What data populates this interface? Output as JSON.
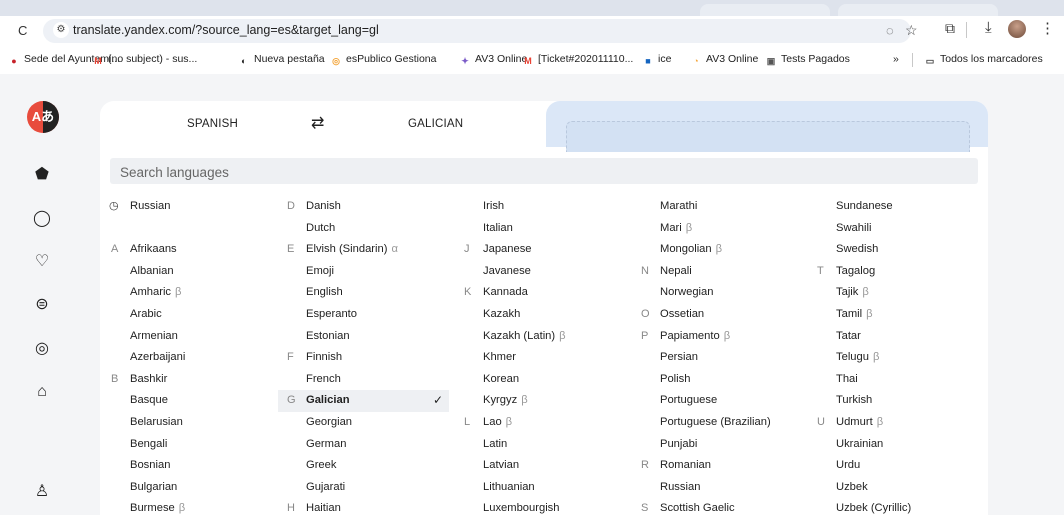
{
  "browser": {
    "url": "translate.yandex.com/?source_lang=es&target_lang=gl",
    "bookmarks": [
      {
        "label": "Sede del Ayuntami...",
        "icon_color": "#c7222a",
        "icon": "●"
      },
      {
        "label": "(no subject) - sus...",
        "icon_color": "#ea4335",
        "icon": "M"
      },
      {
        "label": "Nueva pestaña",
        "icon_color": "#222",
        "icon": "◐"
      },
      {
        "label": "esPublico Gestiona",
        "icon_color": "#f4a63b",
        "icon": "◎"
      },
      {
        "label": "AV3 Online",
        "icon_color": "#7b5cc8",
        "icon": "✦"
      },
      {
        "label": "[Ticket#202011110...",
        "icon_color": "#ea4335",
        "icon": "M"
      },
      {
        "label": "ice",
        "icon_color": "#1565c0",
        "icon": "■"
      },
      {
        "label": "AV3 Online",
        "icon_color": "#f4a63b",
        "icon": "◔"
      },
      {
        "label": "Tests Pagados",
        "icon_color": "#555",
        "icon": "▣"
      }
    ],
    "overflow": "»",
    "all_bookmarks": "Todos los marcadores"
  },
  "app": {
    "logo_text": "Aあ",
    "source_lang": "SPANISH",
    "target_lang": "GALICIAN",
    "swap_icon": "⇄",
    "search_placeholder": "Search languages"
  },
  "columns": [
    [
      {
        "recent": true,
        "name": "Russian"
      },
      {
        "gap": true
      },
      {
        "letter": "A",
        "name": "Afrikaans"
      },
      {
        "name": "Albanian"
      },
      {
        "name": "Amharic",
        "beta": "β"
      },
      {
        "name": "Arabic"
      },
      {
        "name": "Armenian"
      },
      {
        "name": "Azerbaijani"
      },
      {
        "letter": "B",
        "name": "Bashkir"
      },
      {
        "name": "Basque"
      },
      {
        "name": "Belarusian"
      },
      {
        "name": "Bengali"
      },
      {
        "name": "Bosnian"
      },
      {
        "name": "Bulgarian"
      },
      {
        "name": "Burmese",
        "beta": "β"
      }
    ],
    [
      {
        "letter": "D",
        "name": "Danish"
      },
      {
        "name": "Dutch"
      },
      {
        "letter": "E",
        "name": "Elvish (Sindarin)",
        "beta": "α"
      },
      {
        "name": "Emoji"
      },
      {
        "name": "English"
      },
      {
        "name": "Esperanto"
      },
      {
        "name": "Estonian"
      },
      {
        "letter": "F",
        "name": "Finnish"
      },
      {
        "name": "French"
      },
      {
        "letter": "G",
        "name": "Galician",
        "selected": true
      },
      {
        "name": "Georgian"
      },
      {
        "name": "German"
      },
      {
        "name": "Greek"
      },
      {
        "name": "Gujarati"
      },
      {
        "letter": "H",
        "name": "Haitian"
      }
    ],
    [
      {
        "name": "Irish"
      },
      {
        "name": "Italian"
      },
      {
        "letter": "J",
        "name": "Japanese"
      },
      {
        "name": "Javanese"
      },
      {
        "letter": "K",
        "name": "Kannada"
      },
      {
        "name": "Kazakh"
      },
      {
        "name": "Kazakh (Latin)",
        "beta": "β"
      },
      {
        "name": "Khmer"
      },
      {
        "name": "Korean"
      },
      {
        "name": "Kyrgyz",
        "beta": "β"
      },
      {
        "letter": "L",
        "name": "Lao",
        "beta": "β"
      },
      {
        "name": "Latin"
      },
      {
        "name": "Latvian"
      },
      {
        "name": "Lithuanian"
      },
      {
        "name": "Luxembourgish"
      }
    ],
    [
      {
        "name": "Marathi"
      },
      {
        "name": "Mari",
        "beta": "β"
      },
      {
        "name": "Mongolian",
        "beta": "β"
      },
      {
        "letter": "N",
        "name": "Nepali"
      },
      {
        "name": "Norwegian"
      },
      {
        "letter": "O",
        "name": "Ossetian"
      },
      {
        "letter": "P",
        "name": "Papiamento",
        "beta": "β"
      },
      {
        "name": "Persian"
      },
      {
        "name": "Polish"
      },
      {
        "name": "Portuguese"
      },
      {
        "name": "Portuguese (Brazilian)"
      },
      {
        "name": "Punjabi"
      },
      {
        "letter": "R",
        "name": "Romanian"
      },
      {
        "name": "Russian"
      },
      {
        "letter": "S",
        "name": "Scottish Gaelic"
      }
    ],
    [
      {
        "name": "Sundanese"
      },
      {
        "name": "Swahili"
      },
      {
        "name": "Swedish"
      },
      {
        "letter": "T",
        "name": "Tagalog"
      },
      {
        "name": "Tajik",
        "beta": "β"
      },
      {
        "name": "Tamil",
        "beta": "β"
      },
      {
        "name": "Tatar"
      },
      {
        "name": "Telugu",
        "beta": "β"
      },
      {
        "name": "Thai"
      },
      {
        "name": "Turkish"
      },
      {
        "letter": "U",
        "name": "Udmurt",
        "beta": "β"
      },
      {
        "name": "Ukrainian"
      },
      {
        "name": "Urdu"
      },
      {
        "name": "Uzbek"
      },
      {
        "name": "Uzbek (Cyrillic)"
      }
    ]
  ]
}
